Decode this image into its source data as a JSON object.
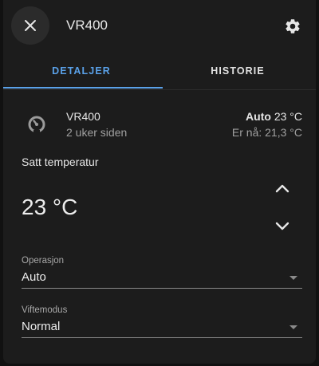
{
  "header": {
    "title": "VR400"
  },
  "tabs": [
    {
      "label": "DETALJER"
    },
    {
      "label": "HISTORIE"
    }
  ],
  "entity": {
    "name": "VR400",
    "last_changed": "2 uker siden",
    "mode": "Auto",
    "target": "23 °C",
    "current": "Er nå: 21,3 °C"
  },
  "setpoint": {
    "label": "Satt temperatur",
    "value": "23 °C"
  },
  "operation": {
    "label": "Operasjon",
    "value": "Auto"
  },
  "fan_mode": {
    "label": "Viftemodus",
    "value": "Normal"
  },
  "colors": {
    "accent": "#5aa1e8",
    "surface": "#1c1c1c",
    "text": "#e1e1e1"
  }
}
